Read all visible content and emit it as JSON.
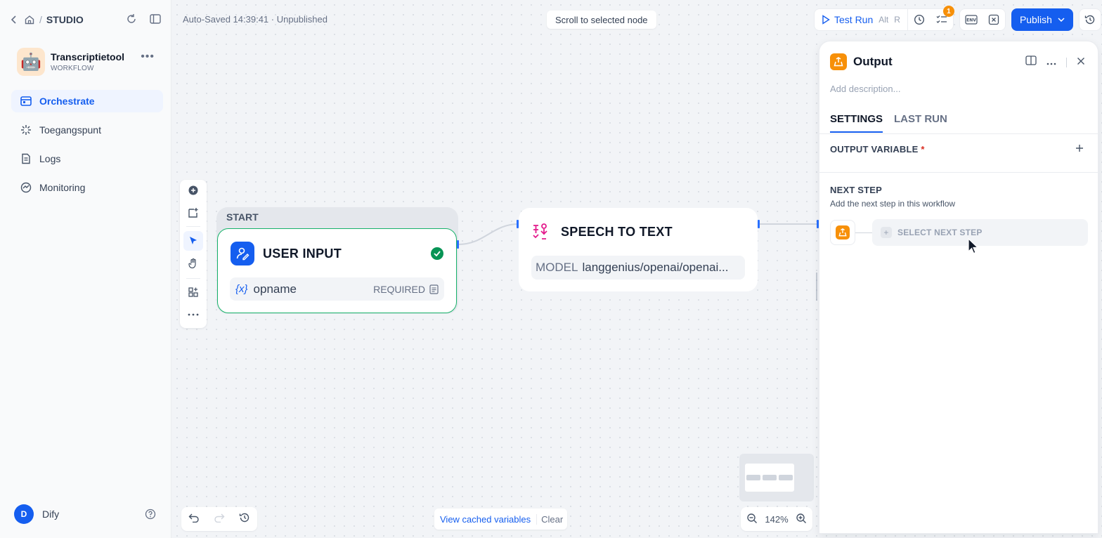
{
  "breadcrumb": {
    "studio": "STUDIO"
  },
  "app": {
    "name": "Transcriptietool",
    "type": "WORKFLOW",
    "emoji": "🤖"
  },
  "nav": [
    {
      "label": "Orchestrate",
      "icon": "orchestrate-icon",
      "active": true
    },
    {
      "label": "Toegangspunt",
      "icon": "access-point-icon",
      "active": false
    },
    {
      "label": "Logs",
      "icon": "logs-icon",
      "active": false
    },
    {
      "label": "Monitoring",
      "icon": "monitoring-icon",
      "active": false
    }
  ],
  "user": {
    "initial": "D",
    "name": "Dify"
  },
  "header": {
    "autosave": "Auto-Saved 14:39:41 · Unpublished",
    "scroll_to_node": "Scroll to selected node",
    "test_run": "Test Run",
    "test_run_kbd_1": "Alt",
    "test_run_kbd_2": "R",
    "checklist_badge": "1",
    "publish": "Publish"
  },
  "nodes": {
    "start_label": "START",
    "user_input": {
      "title": "USER INPUT",
      "var_symbol": "{x}",
      "var_name": "opname",
      "var_required": "REQUIRED"
    },
    "speech_to_text": {
      "title": "SPEECH TO TEXT",
      "model_label": "MODEL",
      "model_value": "langgenius/openai/openai..."
    }
  },
  "bottom": {
    "view_cached": "View cached variables",
    "clear": "Clear",
    "zoom": "142%"
  },
  "panel": {
    "title": "Output",
    "description_placeholder": "Add description...",
    "tabs": [
      "SETTINGS",
      "LAST RUN"
    ],
    "output_variable": "OUTPUT VARIABLE",
    "required_mark": "*",
    "next_step_title": "NEXT STEP",
    "next_step_sub": "Add the next step in this workflow",
    "select_next_step": "SELECT NEXT STEP"
  },
  "colors": {
    "accent": "#155eef",
    "success": "#17b26a",
    "output_node": "#f79009",
    "stt_icon": "#e31b8c"
  }
}
